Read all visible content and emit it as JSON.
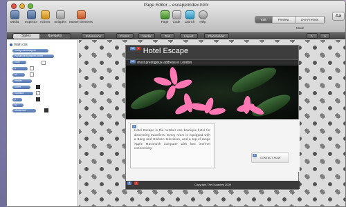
{
  "window": {
    "title": "Page Editor – escape/index.html"
  },
  "toolbar": {
    "left_tools": [
      {
        "label": "Media",
        "icon": "media-icon"
      },
      {
        "label": "Inspector",
        "icon": "inspector-icon"
      },
      {
        "label": "Actions",
        "icon": "actions-icon"
      },
      {
        "label": "Snippets",
        "icon": "snippets-icon"
      },
      {
        "label": "Master Elements",
        "icon": "master-elements-icon"
      }
    ],
    "center_tools": [
      {
        "label": "Page",
        "icon": "page-icon"
      },
      {
        "label": "Code",
        "icon": "code-icon"
      },
      {
        "label": "Launch",
        "icon": "launch-icon"
      },
      {
        "label": "Help",
        "icon": "help-icon"
      }
    ],
    "mode_options": [
      "Edit",
      "Preview",
      "Live Preview"
    ],
    "mode_label": "Mode",
    "aa_label": "Aa"
  },
  "subbar": {
    "tabs": [
      "Styles",
      "Navigator"
    ],
    "elements": [
      "Extensions",
      "Forms",
      "Media",
      "Text",
      "Layout",
      "Placeholder"
    ]
  },
  "sidebar": {
    "file": "main.css",
    "pills": [
      "backgroundwrapper",
      "backgroundwrapper-footer",
      "body",
      "a",
      "h1",
      "header",
      "footer",
      "#contact",
      "p",
      "h2",
      "#footertext"
    ]
  },
  "page": {
    "title": "Hotel Escape",
    "tagline": "most prestigious address in London",
    "paragraph": "Hotel Escape is the number one boutique hotel for discerning travellers. Every room is equipped with a Bang and Olufsen television, and a top-of-range Apple Macintosh computer with free internet connectivity.",
    "contact_label": "CONTACT NOW",
    "footer": "Copyright The Escapers 2009"
  },
  "colors": {
    "accent": "#5d83c2",
    "header_bg": "#3d3d3d",
    "flower": "#ff78b4"
  }
}
